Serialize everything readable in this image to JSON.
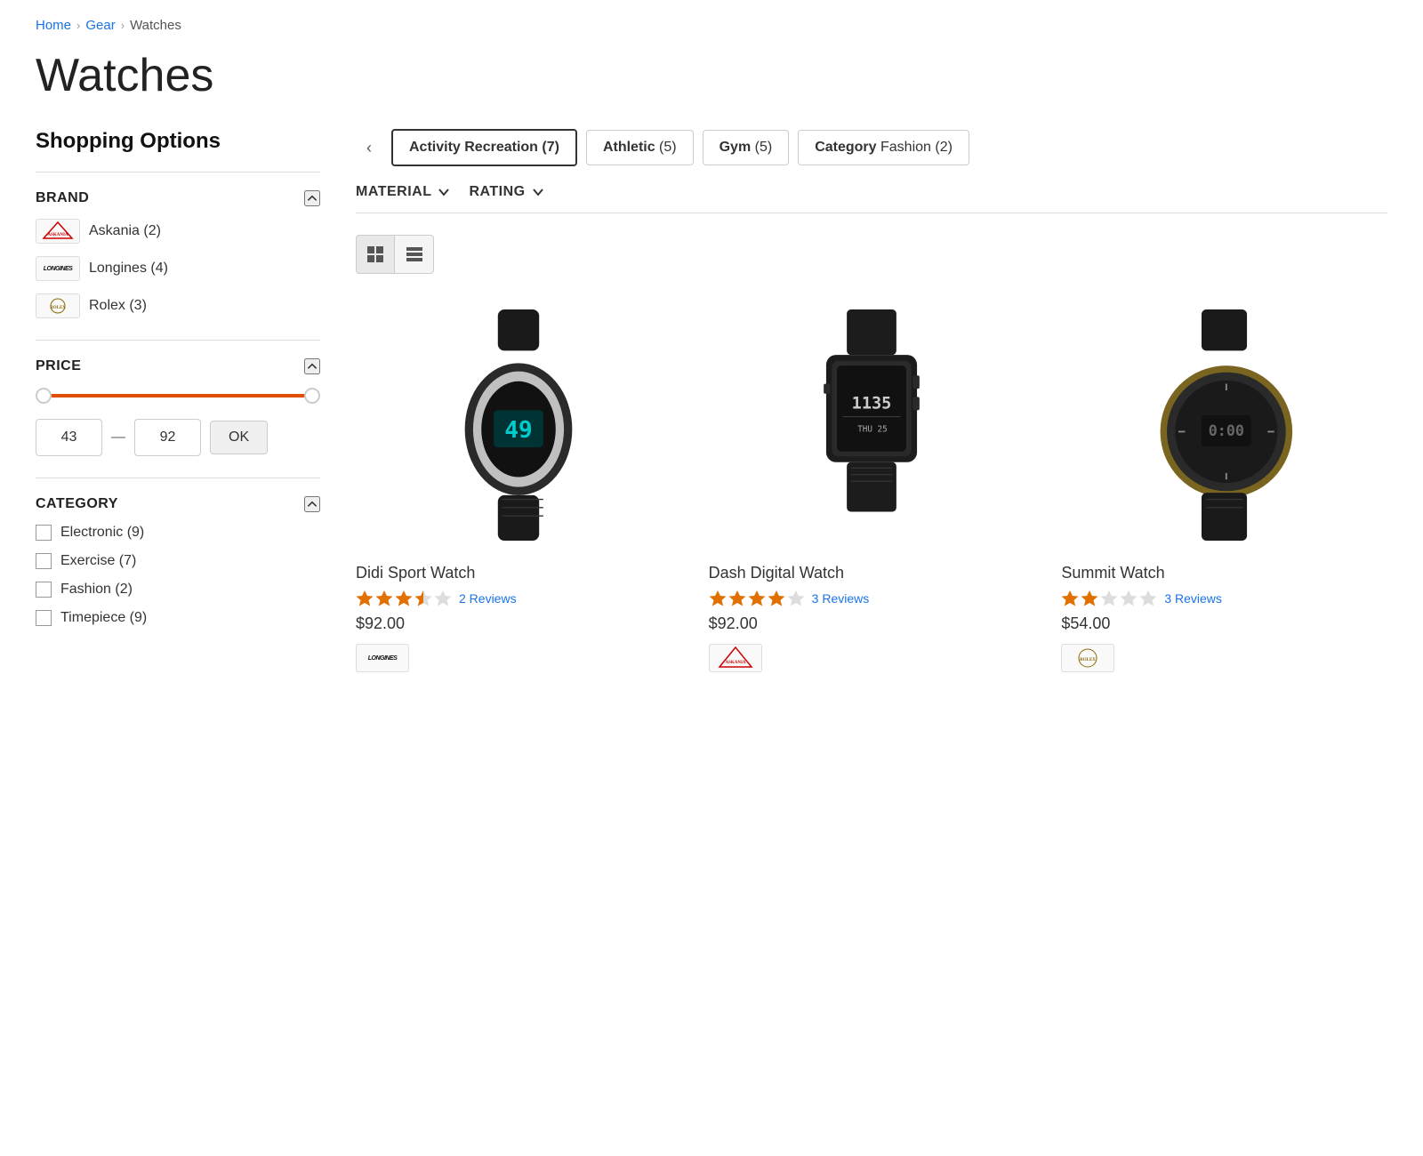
{
  "breadcrumb": {
    "home": "Home",
    "gear": "Gear",
    "current": "Watches"
  },
  "page_title": "Watches",
  "sidebar": {
    "shopping_options_label": "Shopping Options",
    "brand": {
      "label": "BRAND",
      "items": [
        {
          "name": "Askania",
          "count": "(2)",
          "logo_type": "askania"
        },
        {
          "name": "Longines",
          "count": "(4)",
          "logo_type": "longines"
        },
        {
          "name": "Rolex",
          "count": "(3)",
          "logo_type": "rolex"
        }
      ]
    },
    "price": {
      "label": "PRICE",
      "min": "43",
      "max": "92",
      "ok": "OK"
    },
    "category": {
      "label": "CATEGORY",
      "items": [
        {
          "name": "Electronic",
          "count": "(9)"
        },
        {
          "name": "Exercise",
          "count": "(7)"
        },
        {
          "name": "Fashion",
          "count": "(2)"
        },
        {
          "name": "Timepiece",
          "count": "(9)"
        }
      ]
    }
  },
  "filter_tags": [
    {
      "bold": "Activity",
      "rest": " Recreation",
      "count": "(7)",
      "active": true
    },
    {
      "bold": "Athletic",
      "rest": "",
      "count": "(5)",
      "active": false
    },
    {
      "bold": "Gym",
      "rest": "",
      "count": "(5)",
      "active": false
    },
    {
      "bold": "Category",
      "rest": " Fashion",
      "count": "(2)",
      "active": false
    }
  ],
  "sub_filters": [
    {
      "label": "MATERIAL"
    },
    {
      "label": "RATING"
    }
  ],
  "products": [
    {
      "name": "Didi Sport Watch",
      "rating": 3.5,
      "review_count": "2 Reviews",
      "price": "$92.00",
      "brand_type": "longines",
      "watch_type": "didi"
    },
    {
      "name": "Dash Digital Watch",
      "rating": 4,
      "review_count": "3 Reviews",
      "price": "$92.00",
      "brand_type": "askania",
      "watch_type": "dash"
    },
    {
      "name": "Summit Watch",
      "rating": 2,
      "review_count": "3 Reviews",
      "price": "$54.00",
      "brand_type": "rolex",
      "watch_type": "summit"
    }
  ],
  "icons": {
    "chevron_up": "&#8679;",
    "chevron_down": "&#8681;",
    "chevron_left": "&#8249;",
    "grid_icon": "&#9638;",
    "list_icon": "&#9644;"
  }
}
